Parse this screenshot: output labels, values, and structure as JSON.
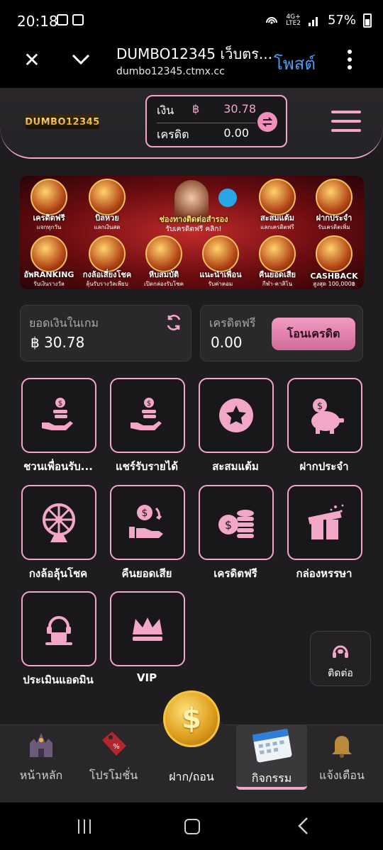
{
  "status_bar": {
    "time": "20:18",
    "network": "4G+",
    "network_sub": "LTE2",
    "battery": "57%"
  },
  "browser": {
    "title": "DUMBO12345 เว็บตร...",
    "url": "dumbo12345.ctmx.cc",
    "post_label": "โพสต์"
  },
  "header": {
    "logo_text": "DUMBO12345",
    "balance_label": "เงิน",
    "currency_symbol": "฿",
    "balance_value": "30.78",
    "credit_label": "เครดิต",
    "credit_value": "0.00"
  },
  "banner": {
    "items": [
      {
        "label": "เครดิตฟรี",
        "sub": "แจกทุกวัน"
      },
      {
        "label": "บิลหวย",
        "sub": "แลกเงินสด"
      },
      {
        "label": "สะสมแต้ม",
        "sub": "แลกเครดิตฟรี"
      },
      {
        "label": "ฝากประจำ",
        "sub": "รับเครดิตเพิ่ม"
      },
      {
        "label": "อัพRANKING",
        "sub": "รับเงินรางวัล"
      },
      {
        "label": "กงล้อเสี่ยงโชค",
        "sub": "ลุ้นรับรางวัลเพียบ"
      },
      {
        "label": "หีบสมบัติ",
        "sub": "เปิดกล่องรับโชค"
      },
      {
        "label": "แนะนำเพื่อน",
        "sub": "รับค่าคอม"
      },
      {
        "label": "คืนยอดเสีย",
        "sub": "กีฬา-คาสิโน"
      },
      {
        "label": "CASHBACK",
        "sub": "สูงสุด 100,000฿"
      }
    ],
    "center_title": "ช่องทางติดต่อสำรอง",
    "center_sub": "รับเครดิตฟรี คลิก!"
  },
  "wallet": {
    "game_balance_label": "ยอดเงินในเกม",
    "game_balance_value": "฿ 30.78",
    "free_credit_label": "เครดิตฟรี",
    "free_credit_value": "0.00",
    "transfer_button": "โอนเครดิต"
  },
  "menu": [
    {
      "label": "ชวนเพื่อนรับ...",
      "icon": "hand-coins-icon"
    },
    {
      "label": "แชร์รับรายได้",
      "icon": "hand-coins-icon"
    },
    {
      "label": "สะสมแต้ม",
      "icon": "star-icon"
    },
    {
      "label": "ฝากประจำ",
      "icon": "piggy-bank-icon"
    },
    {
      "label": "กงล้อลุ้นโชค",
      "icon": "wheel-icon"
    },
    {
      "label": "คืนยอดเสีย",
      "icon": "cashback-hand-icon"
    },
    {
      "label": "เครดิตฟรี",
      "icon": "coin-stack-icon"
    },
    {
      "label": "กล่องหรรษา",
      "icon": "gift-box-icon"
    },
    {
      "label": "ประเมินแอดมิน",
      "icon": "admin-icon"
    },
    {
      "label": "VIP",
      "icon": "crown-icon"
    }
  ],
  "contact": {
    "label": "ติดต่อ"
  },
  "bottom_nav": [
    {
      "label": "หน้าหลัก"
    },
    {
      "label": "โปรโมชั่น"
    },
    {
      "label": "ฝาก/ถอน"
    },
    {
      "label": "กิจกรรม"
    },
    {
      "label": "แจ้งเตือน"
    }
  ],
  "colors": {
    "accent": "#f2a7c8",
    "button": "#e07aaa",
    "background": "#1e1c1f",
    "link": "#4c9cf0"
  }
}
